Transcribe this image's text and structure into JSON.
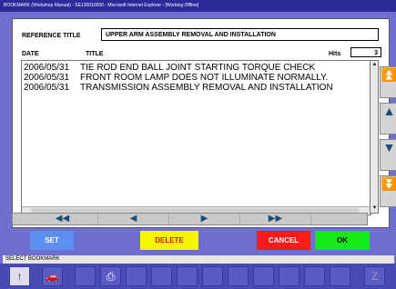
{
  "window": {
    "title": "BOOKMARK (Workshop Manual) - SE130010000 - Microsoft Internet Explorer - [Working Offline]"
  },
  "reference": {
    "label": "REFERENCE TITLE",
    "value": "UPPER ARM ASSEMBLY REMOVAL AND INSTALLATION"
  },
  "headers": {
    "date": "DATE",
    "title": "TITLE",
    "hits_label": "Hits",
    "hits_value": "3"
  },
  "rows": [
    {
      "date": "2006/05/31",
      "title": "TIE ROD END BALL JOINT STARTING TORQUE CHECK"
    },
    {
      "date": "2006/05/31",
      "title": "FRONT ROOM LAMP DOES NOT ILLUMINATE NORMALLY."
    },
    {
      "date": "2006/05/31",
      "title": "TRANSMISSION ASSEMBLY REMOVAL AND INSTALLATION"
    }
  ],
  "nav": {
    "first": "◀◀",
    "prev": "◀",
    "next": "▶",
    "last": "▶▶"
  },
  "actions": {
    "set": "SET",
    "delete": "DELETE",
    "cancel": "CANCEL",
    "ok": "OK"
  },
  "status": {
    "text": "SELECT BOOKMARK"
  },
  "colors": {
    "set": "#5b8ff0",
    "delete": "#f5f500",
    "cancel": "#ff1a1a",
    "ok": "#17e817"
  },
  "icons": {
    "up": "↑",
    "car": "🚗",
    "print": "⎙",
    "exit": "Z"
  }
}
